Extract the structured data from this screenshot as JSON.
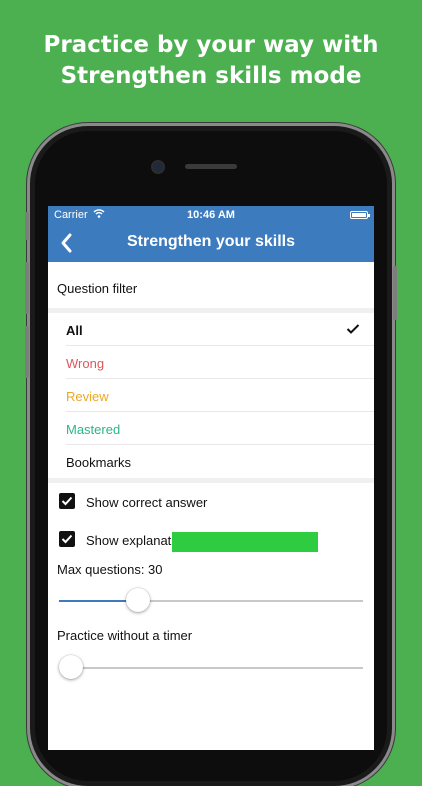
{
  "headline": {
    "line1": "Practice by your way with",
    "line2": "Strengthen skills mode"
  },
  "statusbar": {
    "carrier": "Carrier",
    "time": "10:46 AM"
  },
  "navbar": {
    "title": "Strengthen your skills",
    "back_icon": "chevron-left-icon"
  },
  "filter": {
    "header": "Question filter",
    "options": [
      {
        "label": "All",
        "color": "#111111",
        "selected": true
      },
      {
        "label": "Wrong",
        "color": "#e0565b",
        "selected": false
      },
      {
        "label": "Review",
        "color": "#e8a92a",
        "selected": false
      },
      {
        "label": "Mastered",
        "color": "#2bb58a",
        "selected": false
      },
      {
        "label": "Bookmarks",
        "color": "#111111",
        "selected": false
      }
    ]
  },
  "options": {
    "show_correct_answer": {
      "label": "Show correct answer",
      "checked": true
    },
    "show_explanation": {
      "label": "Show explanation",
      "checked": true
    }
  },
  "max_questions": {
    "label": "Max questions: 30",
    "slider_fraction": 0.24
  },
  "timer": {
    "label": "Practice without a timer",
    "slider_fraction": 0
  },
  "colors": {
    "background": "#4caf50",
    "navbar": "#3d7bbf",
    "start_button": "#2ecc40"
  }
}
